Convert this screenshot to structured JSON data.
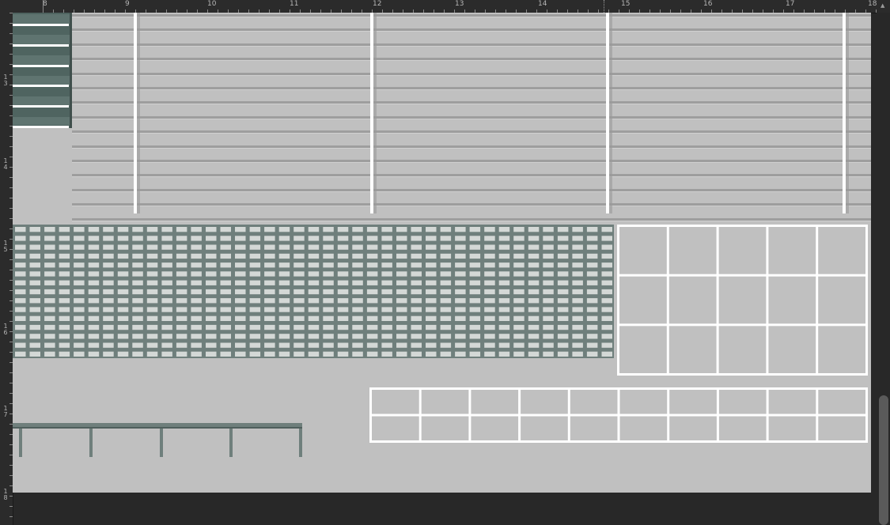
{
  "ruler": {
    "top_labels": [
      "8",
      "9",
      "10",
      "11",
      "12",
      "13",
      "14",
      "15",
      "16",
      "17",
      "18"
    ],
    "left_labels": [
      "3",
      "4",
      "5",
      "6",
      "7",
      "8"
    ]
  },
  "colors": {
    "app_background": "#282828",
    "canvas": "#c0c0c0",
    "grate": "#6f7f7c",
    "stair_tile": "#4f6460",
    "line_light": "#ffffff",
    "line_dark": "#9a9a9a"
  },
  "scrollbar": {
    "up_arrow": "▲"
  }
}
